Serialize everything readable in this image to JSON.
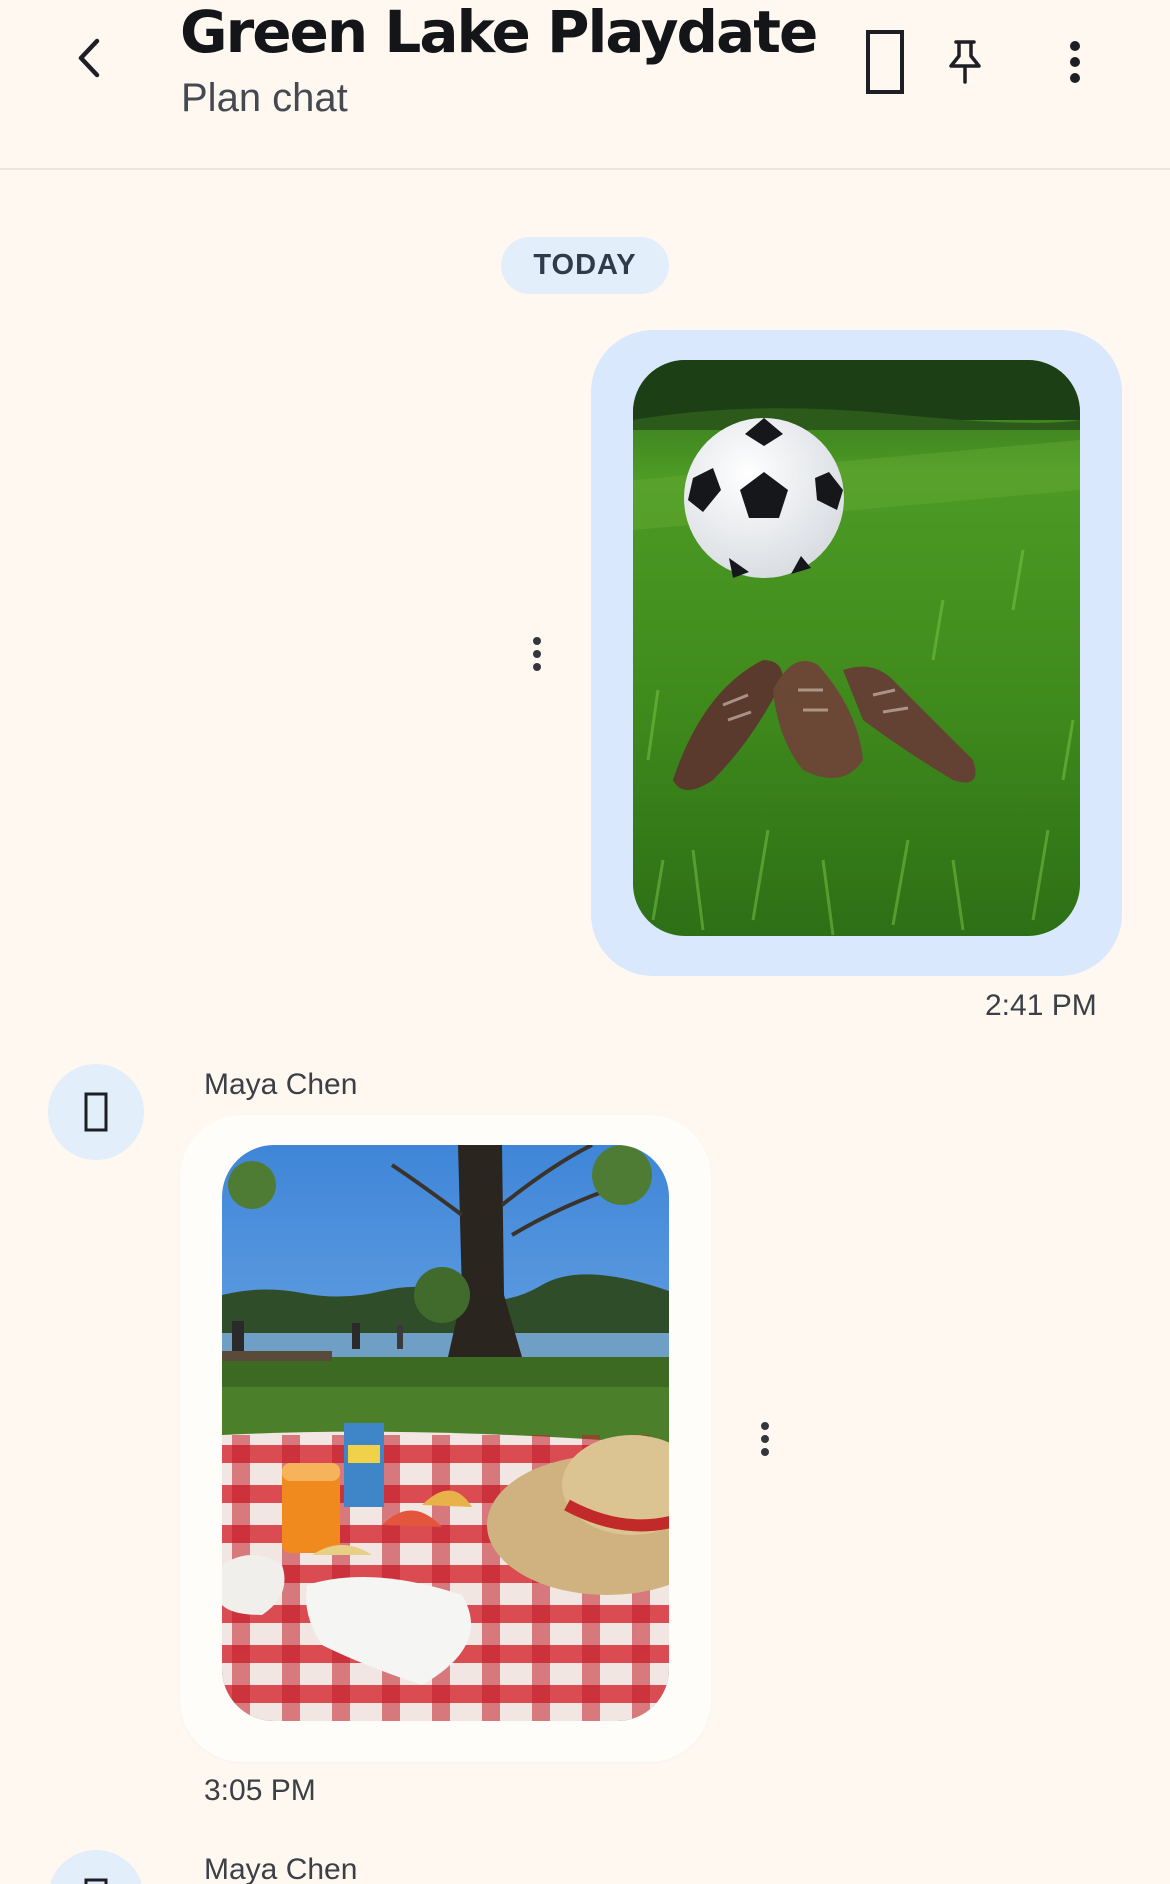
{
  "header": {
    "title": "Green Lake Playdate",
    "subtitle": "Plan chat",
    "icons": [
      "back-icon",
      "document-icon",
      "pin-icon",
      "more-vertical-icon"
    ]
  },
  "date_divider": "TODAY",
  "messages": [
    {
      "direction": "outgoing",
      "content": "photo",
      "photo_subject": "soccer-ball-and-cleats-on-grass",
      "time": "2:41 PM"
    },
    {
      "direction": "incoming",
      "sender": "Maya Chen",
      "content": "photo",
      "photo_subject": "picnic-blanket-by-lake",
      "time": "3:05 PM"
    },
    {
      "direction": "incoming",
      "sender": "Maya Chen"
    }
  ],
  "colors": {
    "background": "#fff8f1",
    "outgoing_bubble": "#d9e8fc",
    "incoming_bubble": "#fffdf9",
    "pill": "#e3eefb",
    "title": "#141519"
  }
}
